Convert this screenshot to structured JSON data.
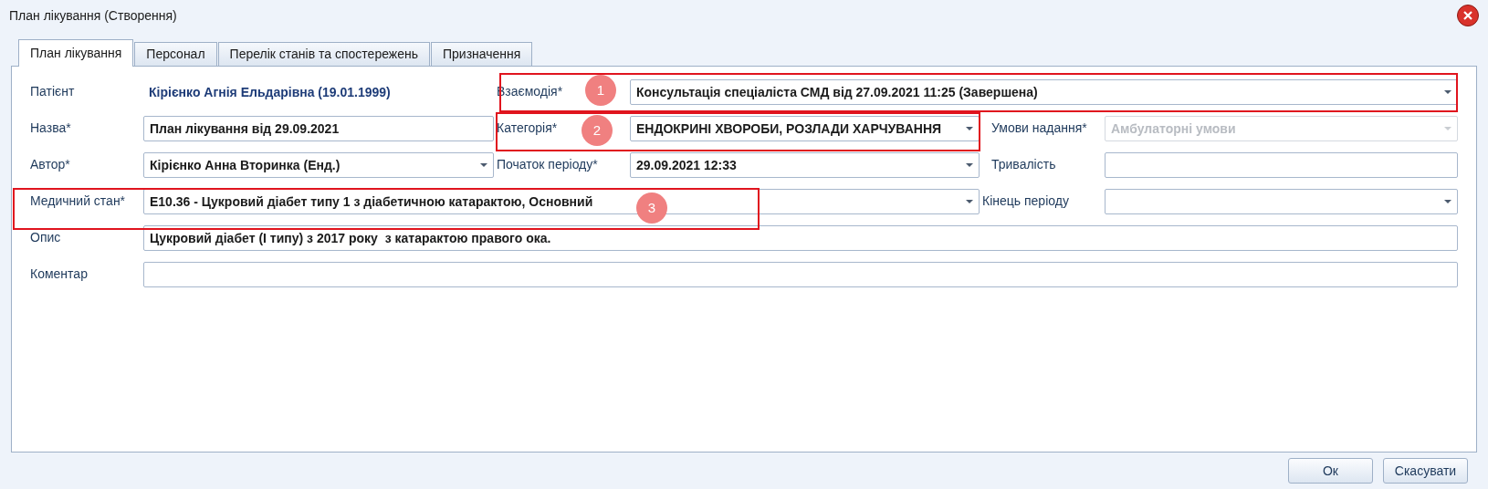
{
  "window": {
    "title": "План лікування (Створення)"
  },
  "tabs": [
    {
      "label": "План лікування",
      "selected": true
    },
    {
      "label": "Персонал",
      "selected": false
    },
    {
      "label": "Перелік станів та спостережень",
      "selected": false
    },
    {
      "label": "Призначення",
      "selected": false
    }
  ],
  "rows": [
    {
      "fields": [
        {
          "label": "Патієнт",
          "kind": "display",
          "value": "Кірієнко Агнія Ельдарівна (19.01.1999)"
        },
        {
          "label": "Взаємодія*",
          "kind": "combo",
          "wide": true,
          "disabled": false,
          "value": "Консультація спеціаліста СМД від 27.09.2021 11:25 (Завершена)"
        }
      ]
    },
    {
      "fields": [
        {
          "label": "Назва*",
          "kind": "text",
          "disabled": false,
          "value": "План лікування від 29.09.2021"
        },
        {
          "label": "Категорія*",
          "kind": "combo",
          "disabled": false,
          "value": "ЕНДОКРИНІ ХВОРОБИ, РОЗЛАДИ ХАРЧУВАННЯ"
        },
        {
          "label": "Умови надання*",
          "kind": "combo",
          "disabled": true,
          "value": "Амбулаторні умови"
        }
      ]
    },
    {
      "fields": [
        {
          "label": "Автор*",
          "kind": "combo",
          "disabled": false,
          "value": "Кірієнко Анна Вторинка (Енд.)"
        },
        {
          "label": "Початок періоду*",
          "kind": "combo",
          "disabled": false,
          "value": "29.09.2021 12:33"
        },
        {
          "label": "Тривалість",
          "kind": "text",
          "disabled": false
        }
      ]
    },
    {
      "fields": [
        {
          "label": "Медичний стан*",
          "kind": "combo",
          "wide": true,
          "disabled": false,
          "value": "E10.36 - Цукровий діабет типу 1 з діабетичною катарактою, Основний"
        },
        {
          "label": "Кінець періоду",
          "kind": "combo",
          "disabled": false
        }
      ]
    },
    {
      "fields": [
        {
          "label": "Опис",
          "kind": "text",
          "disabled": false,
          "value": "Цукровий діабет (І типу) з 2017 року  з катарактою правого ока."
        }
      ]
    },
    {
      "fields": [
        {
          "label": "Коментар",
          "kind": "text",
          "disabled": false
        }
      ]
    }
  ],
  "annotations": [
    {
      "number": "1"
    },
    {
      "number": "2"
    },
    {
      "number": "3"
    }
  ],
  "buttons": [
    {
      "label": "Ок"
    },
    {
      "label": "Скасувати"
    }
  ]
}
